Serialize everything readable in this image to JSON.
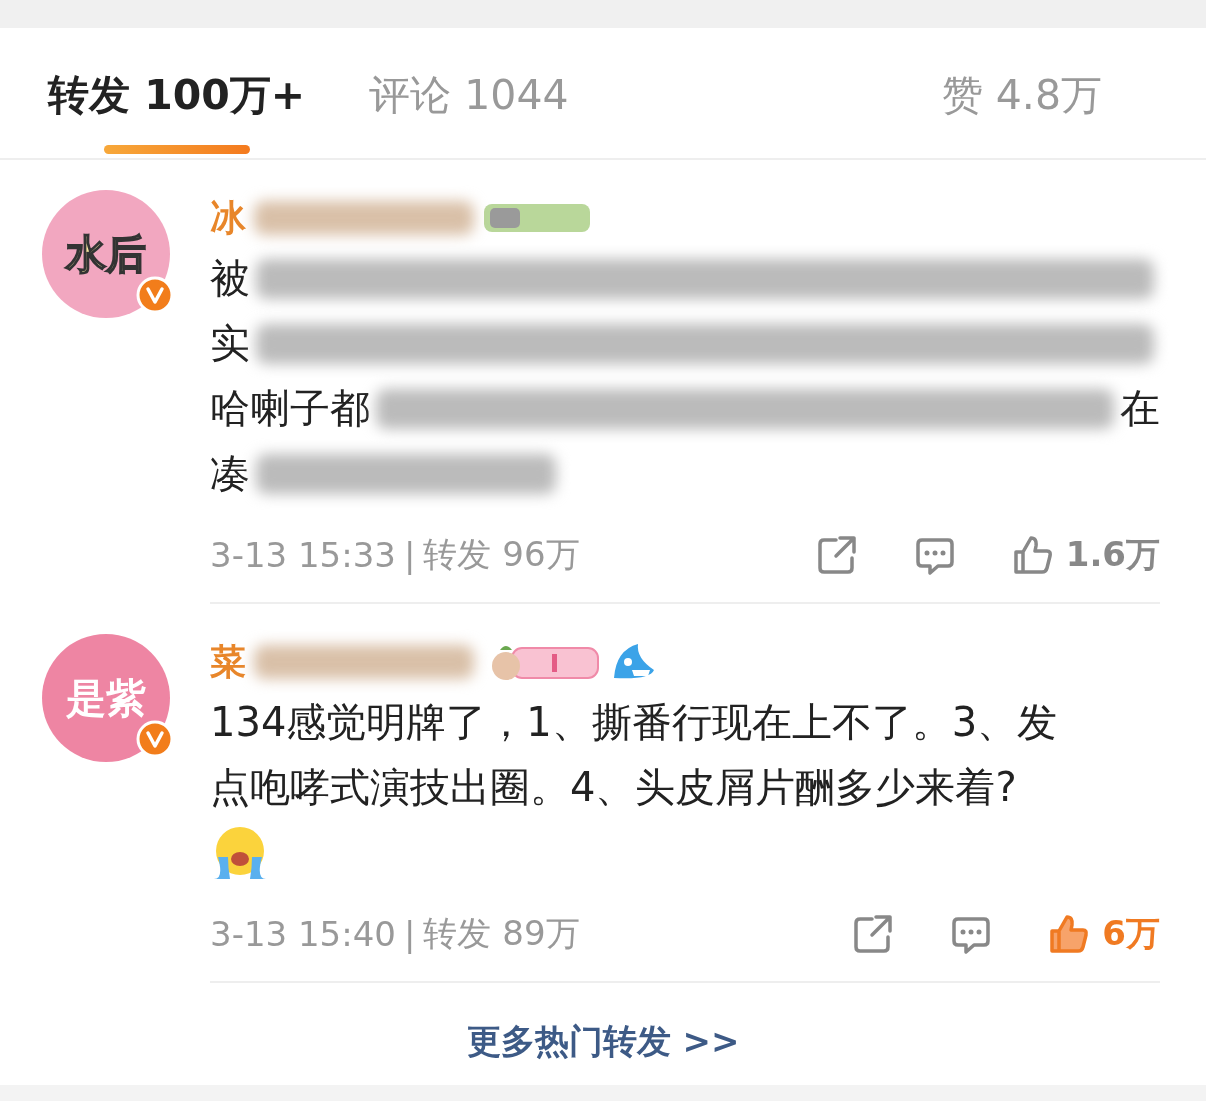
{
  "tabs": [
    {
      "label": "转发",
      "count": "100万+",
      "selected": true
    },
    {
      "label": "评论",
      "count": "1044",
      "selected": false
    }
  ],
  "likes_tab": {
    "label": "赞",
    "count": "4.8万"
  },
  "comments": [
    {
      "avatar_text": "水后",
      "verified": true,
      "name": "冰",
      "name_extras": [
        {
          "kind": "blur"
        },
        {
          "kind": "level_badge"
        }
      ],
      "lines": [
        [
          {
            "kind": "text",
            "text": "被"
          },
          {
            "kind": "blur"
          }
        ],
        [
          {
            "kind": "text",
            "text": "实"
          },
          {
            "kind": "blur"
          }
        ],
        [
          {
            "kind": "text",
            "text": "哈喇子都"
          },
          {
            "kind": "blur"
          },
          {
            "kind": "text",
            "text": "在"
          }
        ],
        [
          {
            "kind": "text",
            "text": "凑"
          },
          {
            "kind": "blur_short"
          }
        ]
      ],
      "time": "3-13 15:33",
      "separator": "|",
      "repost": "转发 96万",
      "like_count": "1.6万",
      "liked": false
    },
    {
      "avatar_text": "是紫",
      "verified": true,
      "name": "菜",
      "name_extras": [
        {
          "kind": "blur"
        },
        {
          "kind": "sticker_badge"
        },
        {
          "kind": "shark"
        }
      ],
      "lines": [
        [
          {
            "kind": "text",
            "text": "134感觉明牌了，1、撕番行现在上不了。3、发"
          }
        ],
        [
          {
            "kind": "text",
            "text": "点咆哮式演技出圈。4、头皮屑片酬多少来着?"
          }
        ],
        [
          {
            "kind": "emoji"
          }
        ]
      ],
      "time": "3-13 15:40",
      "separator": "|",
      "repost": "转发 89万",
      "like_count": "6万",
      "liked": true
    }
  ],
  "more_link": "更多热门转发 >>"
}
